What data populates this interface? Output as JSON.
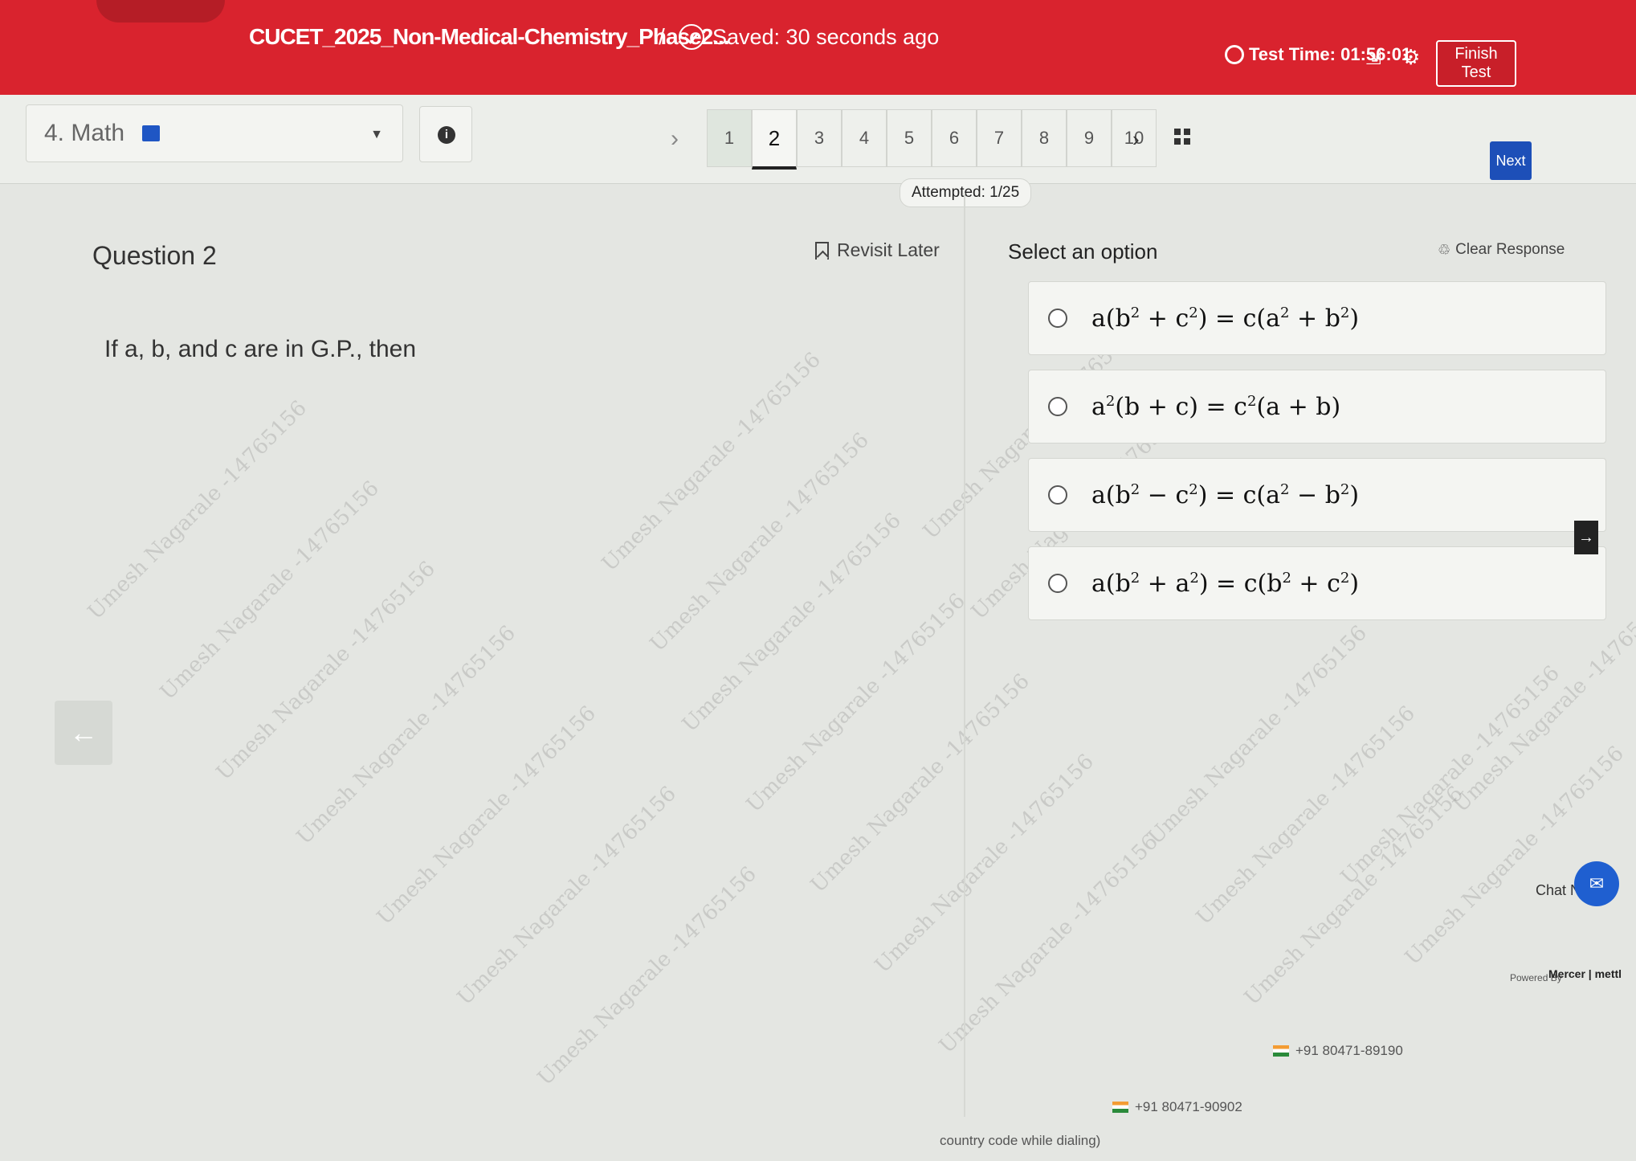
{
  "header": {
    "title": "CUCET_2025_Non-Medical-Chemistry_Phase2...",
    "separator": "/",
    "saved": "Saved: 30 seconds ago",
    "test_time": "Test Time: 01:56:01",
    "finish_label": "Finish Test",
    "brand_color": "#d9232e"
  },
  "toolbar": {
    "subject": "4. Math",
    "info_glyph": "i",
    "prev_glyph": "›",
    "next_glyph": "›",
    "questions": [
      "1",
      "2",
      "3",
      "4",
      "5",
      "6",
      "7",
      "8",
      "9",
      "10"
    ],
    "active_question": "2",
    "next_label": "Next"
  },
  "attempted": "Attempted: 1/25",
  "question": {
    "title": "Question 2",
    "revisit": "Revisit Later",
    "text": "If a, b, and c are in G.P., then"
  },
  "options": {
    "label": "Select an option",
    "clear": "Clear Response",
    "items": [
      {
        "pre": "a(b",
        "s1": "2",
        "m1": " + c",
        "s2": "2",
        "m2": ") = c(a",
        "s3": "2",
        "m3": " + b",
        "s4": "2",
        "post": ")"
      },
      {
        "pre": "a",
        "s1": "2",
        "m1": "(b + c) = c",
        "s2": "2",
        "m2": "(a + b)",
        "s3": "",
        "m3": "",
        "s4": "",
        "post": ""
      },
      {
        "pre": "a(b",
        "s1": "2",
        "m1": " − c",
        "s2": "2",
        "m2": ") = c(a",
        "s3": "2",
        "m3": " − b",
        "s4": "2",
        "post": ")"
      },
      {
        "pre": "a(b",
        "s1": "2",
        "m1": " + a",
        "s2": "2",
        "m2": ") = c(b",
        "s3": "2",
        "m3": " + c",
        "s4": "2",
        "post": ")"
      }
    ]
  },
  "footer": {
    "chat": "Chat Now",
    "powered": "Powered By",
    "mercer": "Mercer | mettl",
    "phone1": "+91 80471-89190",
    "phone2": "+91 80471-90902",
    "note": "country code while dialing)"
  },
  "watermark": "Umesh Nagarale -14765156"
}
